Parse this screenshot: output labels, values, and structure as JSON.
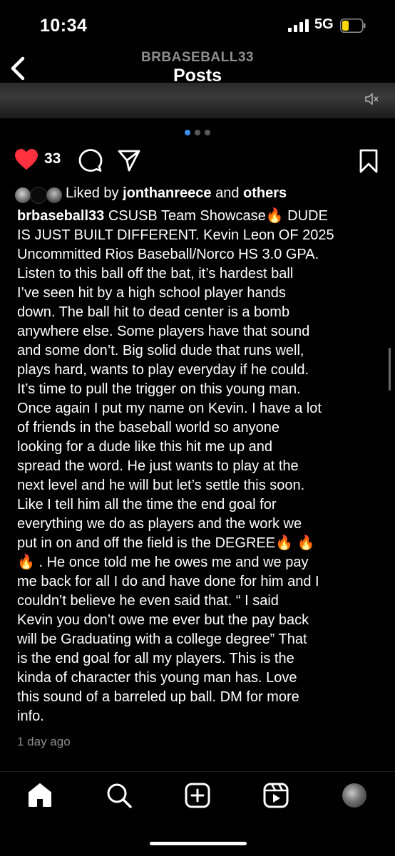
{
  "status": {
    "time": "10:34",
    "network": "5G"
  },
  "header": {
    "account": "BRBASEBALL33",
    "title": "Posts"
  },
  "post": {
    "like_count": "33",
    "liked_by_prefix": "Liked by ",
    "liked_by_user": "jonthanreece",
    "liked_by_and": " and ",
    "liked_by_others": "others",
    "caption_user": "brbaseball33",
    "caption_lines": [
      " CSUSB Team Showcase🔥 DUDE",
      "IS JUST BUILT DIFFERENT. Kevin Leon OF 2025",
      "Uncommitted Rios Baseball/Norco HS 3.0 GPA.",
      "Listen to this ball off the bat, it’s hardest ball",
      "I’ve seen hit by a high school player hands",
      "down. The ball hit to dead center is a bomb",
      "anywhere else.  Some players have that sound",
      "and some don’t.  Big solid dude that runs well,",
      "plays hard, wants to play everyday if he could.",
      "It’s time to pull the trigger on this young man.",
      "Once again I put my name on Kevin. I have a lot",
      "of friends in the baseball world so anyone",
      "looking for a dude like this hit me up and",
      "spread the word.  He just wants to play at the",
      "next level and he will but let’s settle this soon.",
      "Like I tell him all the time the end goal for",
      "everything we do as players and the work we",
      "put in on and off the field is the DEGREE🔥 🔥",
      "🔥 . He once told me he owes me and we pay",
      "me back for  all I do and have done for him and I",
      "couldn’t believe he even said that. “ I said",
      "Kevin you don’t owe me ever but the pay back",
      "will be Graduating with a college degree” That",
      "is the end goal for all my players.  This is the",
      "kinda of character this young man has. Love",
      "this sound of a barreled up ball.  DM for more",
      "info."
    ],
    "timestamp": "1 day ago"
  },
  "icons": {
    "back": "chevron-left-icon",
    "like": "heart-filled-icon",
    "comment": "comment-bubble-icon",
    "share": "paper-plane-icon",
    "save": "bookmark-icon",
    "home": "home-icon",
    "search": "search-icon",
    "create": "plus-square-icon",
    "reels": "reels-icon",
    "profile": "profile-avatar"
  },
  "colors": {
    "background": "#000000",
    "like": "#ff3040",
    "muted_text": "#8e8e8e",
    "active_dot": "#3a8ff0",
    "battery_fill": "#ffd60a"
  }
}
